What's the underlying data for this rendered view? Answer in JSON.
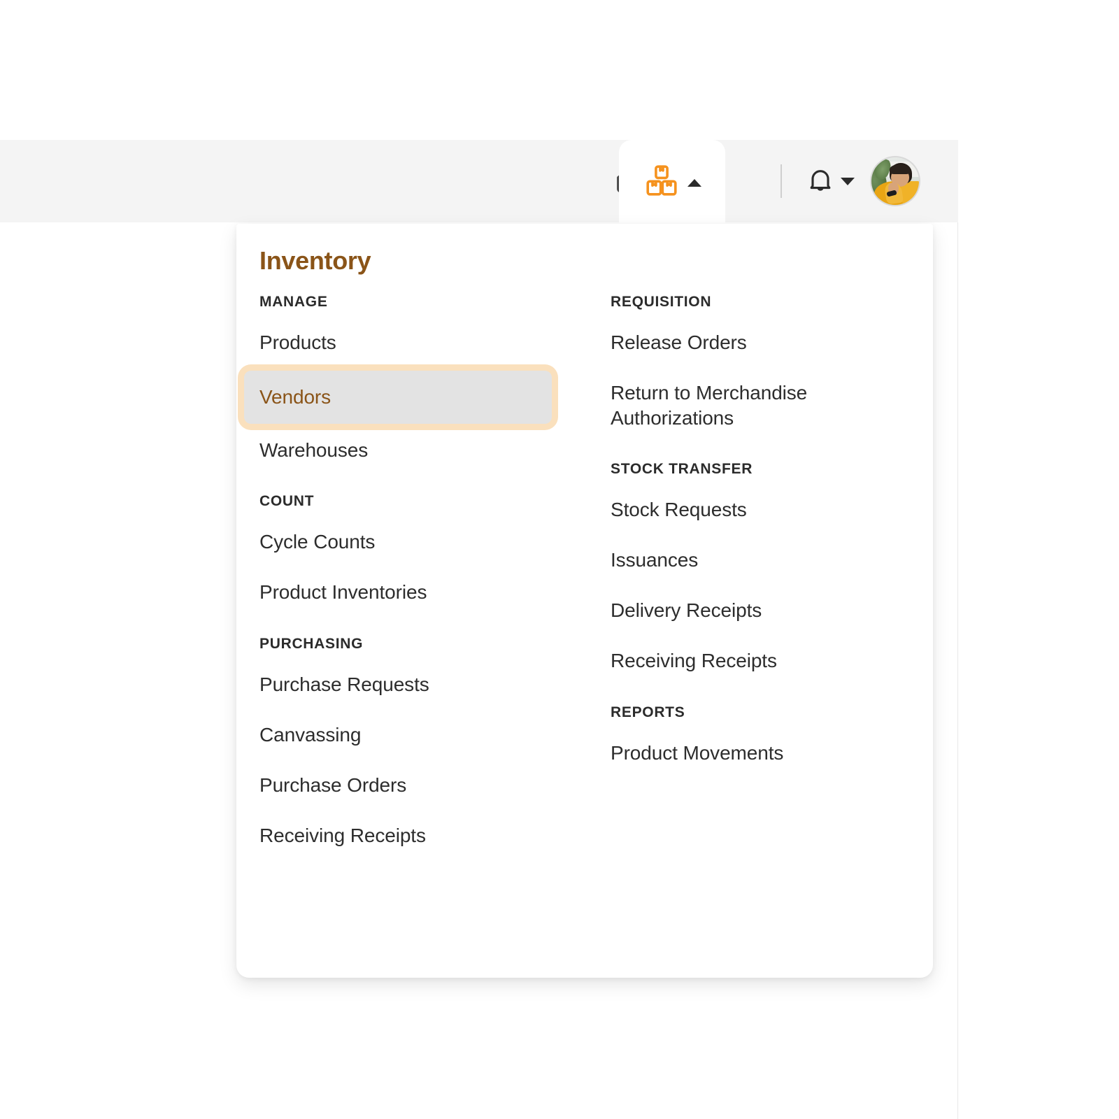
{
  "header": {
    "home_icon": "home-icon",
    "inventory_tab": {
      "icon": "boxes-icon",
      "label": "Inventory",
      "caret": "caret-up-icon",
      "active": true
    },
    "notifications_icon": "bell-icon",
    "notifications_caret": "caret-down-icon",
    "avatar": "user-avatar",
    "bar_color": "#f4f4f4",
    "accent_color": "#f5921e"
  },
  "menu": {
    "title": "Inventory",
    "title_color": "#8a5418",
    "selected_item": "Vendors",
    "selected_bg": "#e3e3e3",
    "focus_ring_color": "#fae0bd",
    "left_groups": [
      {
        "heading": "MANAGE",
        "items": [
          "Products",
          "Vendors",
          "Warehouses"
        ]
      },
      {
        "heading": "COUNT",
        "items": [
          "Cycle Counts",
          "Product Inventories"
        ]
      },
      {
        "heading": "PURCHASING",
        "items": [
          "Purchase Requests",
          "Canvassing",
          "Purchase Orders",
          "Receiving Receipts"
        ]
      }
    ],
    "right_groups": [
      {
        "heading": "REQUISITION",
        "items": [
          "Release Orders",
          "Return to Merchandise Authorizations"
        ]
      },
      {
        "heading": "STOCK TRANSFER",
        "items": [
          "Stock Requests",
          "Issuances",
          "Delivery Receipts",
          "Receiving Receipts"
        ]
      },
      {
        "heading": "REPORTS",
        "items": [
          "Product Movements"
        ]
      }
    ]
  }
}
